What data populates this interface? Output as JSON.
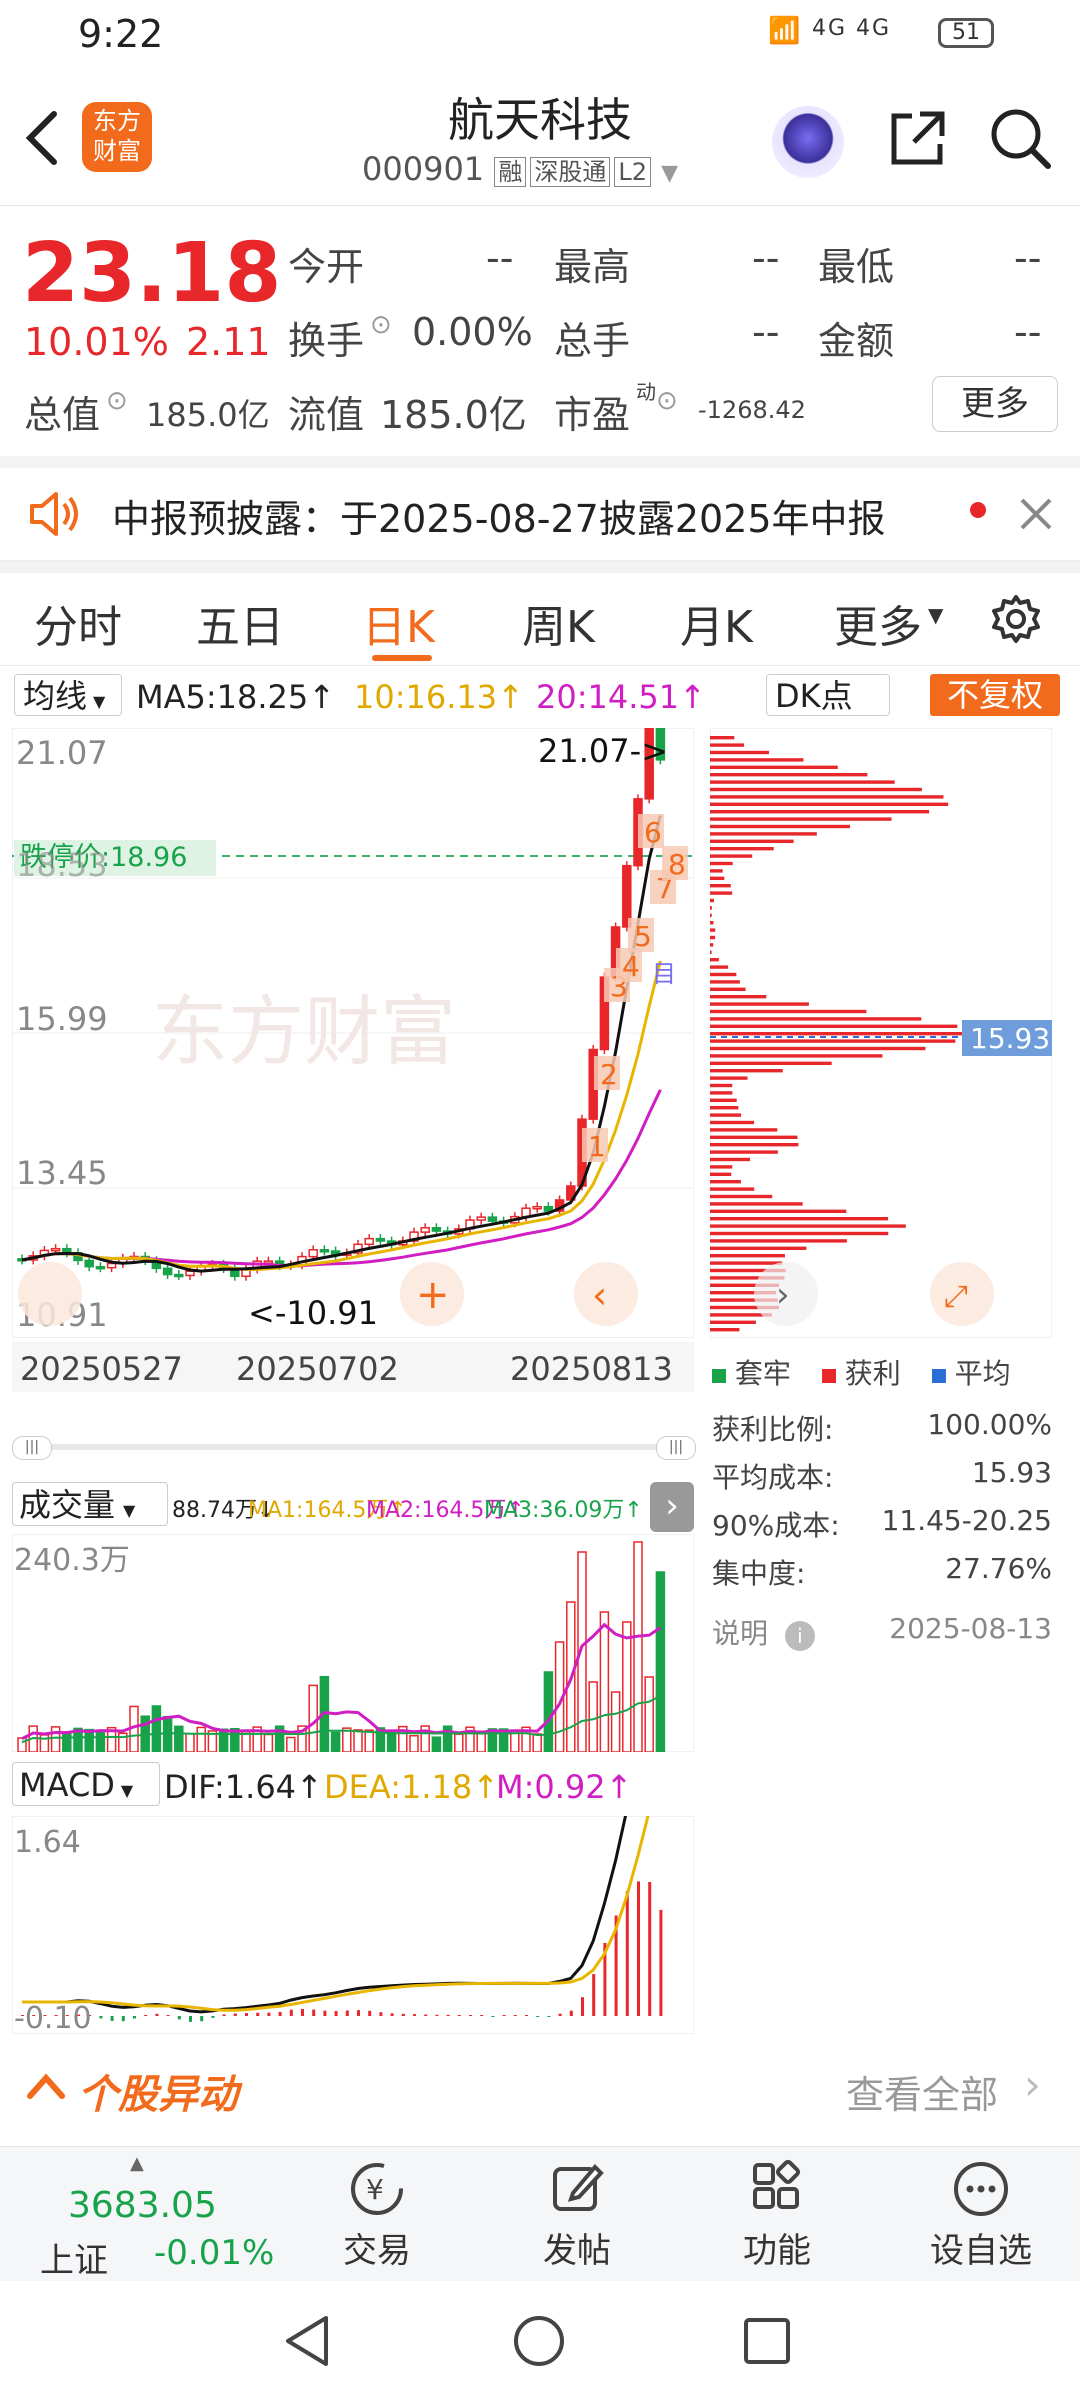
{
  "status_bar": {
    "time": "9:22",
    "network": "4G 4G",
    "battery": "51"
  },
  "header": {
    "logo_text": "东方\n财富",
    "title": "航天科技",
    "code": "000901",
    "badges": [
      "融",
      "深股通",
      "L2"
    ]
  },
  "quote": {
    "price": "23.18",
    "change_pct": "10.01%",
    "change_abs": "2.11",
    "today_open_label": "今开",
    "today_open": "--",
    "high_label": "最高",
    "high": "--",
    "low_label": "最低",
    "low": "--",
    "turnover_label": "换手",
    "turnover": "0.00%",
    "volume_label": "总手",
    "volume": "--",
    "amount_label": "金额",
    "amount": "--",
    "total_value_label": "总值",
    "total_value": "185.0亿",
    "float_value_label": "流值",
    "float_value": "185.0亿",
    "pe_label": "市盈",
    "pe_sup": "动",
    "pe": "-1268.42",
    "more_button": "更多"
  },
  "notice": {
    "text": "中报预披露：于2025-08-27披露2025年中报"
  },
  "tabs": [
    "分时",
    "五日",
    "日K",
    "周K",
    "月K",
    "更多"
  ],
  "active_tab": "日K",
  "ma_bar": {
    "selector": "均线",
    "ma5": "MA5:18.25↑",
    "ma10": "10:16.13↑",
    "ma20": "20:14.51↑",
    "dk": "DK点",
    "fq": "不复权"
  },
  "kchart": {
    "y_labels": [
      "21.07",
      "18.53",
      "15.99",
      "13.45",
      "10.91"
    ],
    "limit_down": "跌停价:18.96",
    "high_mark": "21.07->",
    "low_mark": "<-10.91",
    "dates": [
      "20250527",
      "20250702",
      "20250813"
    ],
    "watermark": "东方财富",
    "markers": [
      "1",
      "2",
      "3",
      "4",
      "5",
      "6",
      "7",
      "8"
    ],
    "today_flag": "目"
  },
  "chip": {
    "avg_label": "15.93",
    "legend": [
      "套牢",
      "获利",
      "平均"
    ],
    "stats": [
      {
        "k": "获利比例:",
        "v": "100.00%"
      },
      {
        "k": "平均成本:",
        "v": "15.93"
      },
      {
        "k": "90%成本:",
        "v": "11.45-20.25"
      },
      {
        "k": "集中度:",
        "v": "27.76%"
      }
    ],
    "note_label": "说明",
    "note_date": "2025-08-13"
  },
  "volume": {
    "selector": "成交量",
    "vol": "88.74万↓",
    "ma1": "MA1:164.5万↑",
    "ma2": "MA2:164.5万↑",
    "ma3": "MA3:36.09万↑",
    "ymax": "240.3万"
  },
  "macd": {
    "selector": "MACD",
    "dif": "DIF:1.64↑",
    "dea": "DEA:1.18↑",
    "m": "M:0.92↑",
    "ymax": "1.64",
    "ymin": "-0.10"
  },
  "abnormal": {
    "title": "个股异动",
    "view_all": "查看全部"
  },
  "bottom_nav": {
    "index_value": "3683.05",
    "index_name": "上证",
    "index_change": "-0.01%",
    "items": [
      {
        "label": "交易",
        "icon": "trade-icon"
      },
      {
        "label": "发帖",
        "icon": "post-icon"
      },
      {
        "label": "功能",
        "icon": "grid-icon"
      },
      {
        "label": "设自选",
        "icon": "more-icon"
      }
    ]
  },
  "colors": {
    "red": "#e8272b",
    "green": "#18a34a",
    "orange": "#f26a1b",
    "yellow": "#e0a800",
    "magenta": "#d11ec3"
  }
}
